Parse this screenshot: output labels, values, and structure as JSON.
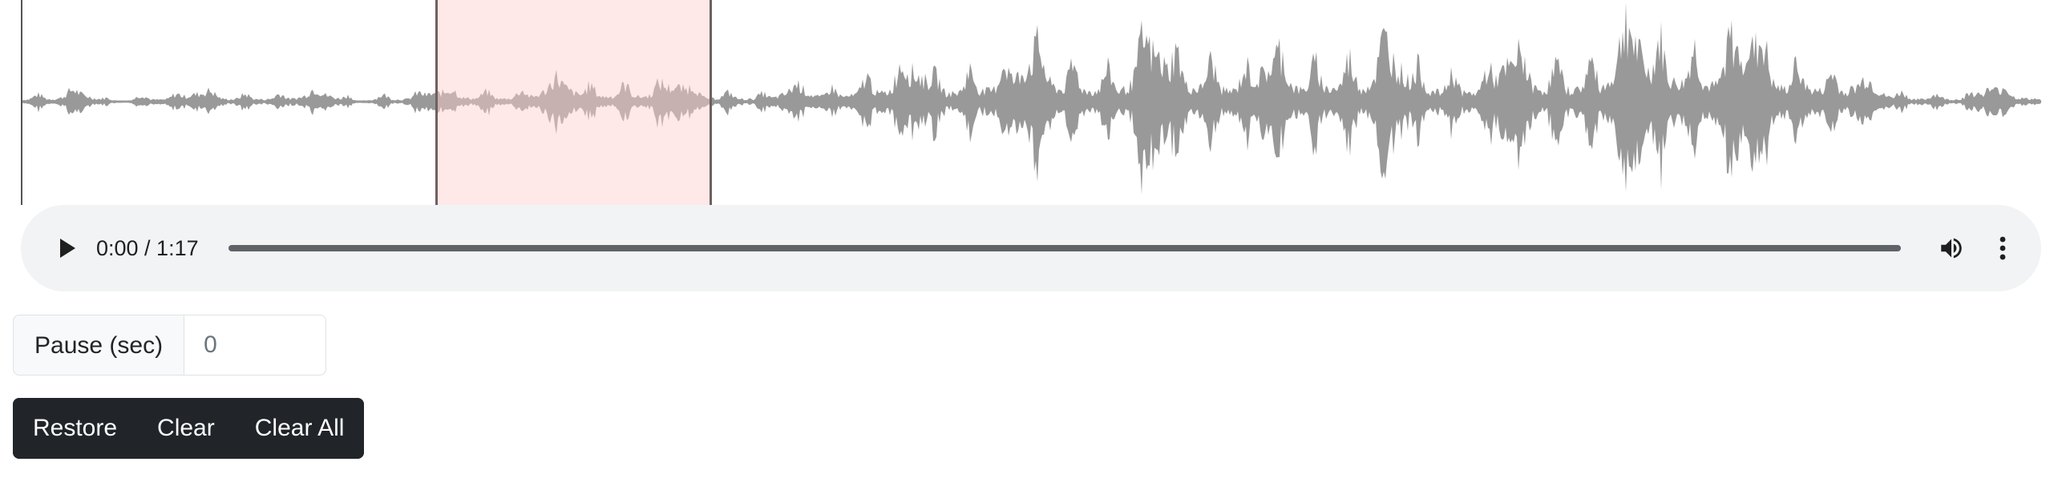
{
  "player": {
    "time_display": "0:00 / 1:17",
    "current_time": "0:00",
    "duration": "1:17",
    "progress": 0
  },
  "pause": {
    "label": "Pause (sec)",
    "value": "0"
  },
  "actions": {
    "restore_label": "Restore",
    "clear_label": "Clear",
    "clear_all_label": "Clear All"
  },
  "colors": {
    "waveform": "#999999",
    "region": "#ffcdcd",
    "player_bg": "#f1f3f4",
    "button_dark": "#212529"
  },
  "icons": {
    "play": "play-icon",
    "volume": "volume-icon",
    "menu": "more-vert-icon"
  }
}
